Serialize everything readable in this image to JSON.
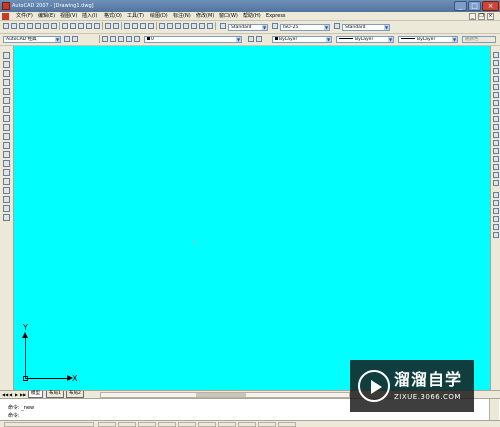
{
  "window": {
    "title": "AutoCAD 2007 - [Drawing1.dwg]",
    "minimize_glyph": "_",
    "maximize_glyph": "□",
    "close_glyph": "×"
  },
  "menubar": {
    "items": [
      "文件(F)",
      "编辑(E)",
      "视图(V)",
      "插入(I)",
      "格式(O)",
      "工具(T)",
      "绘图(D)",
      "标注(N)",
      "修改(M)",
      "窗口(W)",
      "帮助(H)",
      "Express"
    ],
    "doc_minimize": "_",
    "doc_restore": "❐",
    "doc_close": "×"
  },
  "styles_toolbar": {
    "text_style": "Standard",
    "dim_style": "ISO-25",
    "table_style": "Standard"
  },
  "workspace_toolbar": {
    "workspace": "AutoCAD 经典",
    "layer": "0",
    "color": "ByLayer",
    "linetype": "ByLayer",
    "lineweight": "ByLayer",
    "plot_style": "随颜色"
  },
  "canvas": {
    "background_color": "#00FFFF",
    "ucs_y_label": "Y",
    "ucs_x_label": "X"
  },
  "layout_tabs": {
    "nav": [
      "◀◀",
      "◀",
      "▶",
      "▶▶"
    ],
    "tabs": [
      "模型",
      "布局1",
      "布局2"
    ],
    "active": "模型"
  },
  "command": {
    "history_line": "命令: _new",
    "prompt": "命令:"
  },
  "watermark": {
    "title": "溜溜自学",
    "url": "ZIXUE.3066.COM"
  },
  "icons": {
    "left_toolbar": [
      "line-icon",
      "construction-line-icon",
      "polyline-icon",
      "polygon-icon",
      "rectangle-icon",
      "arc-icon",
      "circle-icon",
      "revision-cloud-icon",
      "spline-icon",
      "ellipse-icon",
      "ellipse-arc-icon",
      "insert-block-icon",
      "make-block-icon",
      "point-icon",
      "hatch-icon",
      "gradient-icon",
      "region-icon",
      "table-icon",
      "multiline-text-icon"
    ],
    "right_toolbar": [
      "erase-icon",
      "copy-icon",
      "mirror-icon",
      "offset-icon",
      "array-icon",
      "move-icon",
      "rotate-icon",
      "scale-icon",
      "stretch-icon",
      "trim-icon",
      "extend-icon",
      "break-at-point-icon",
      "break-icon",
      "join-icon",
      "chamfer-icon",
      "fillet-icon",
      "explode-icon"
    ]
  }
}
